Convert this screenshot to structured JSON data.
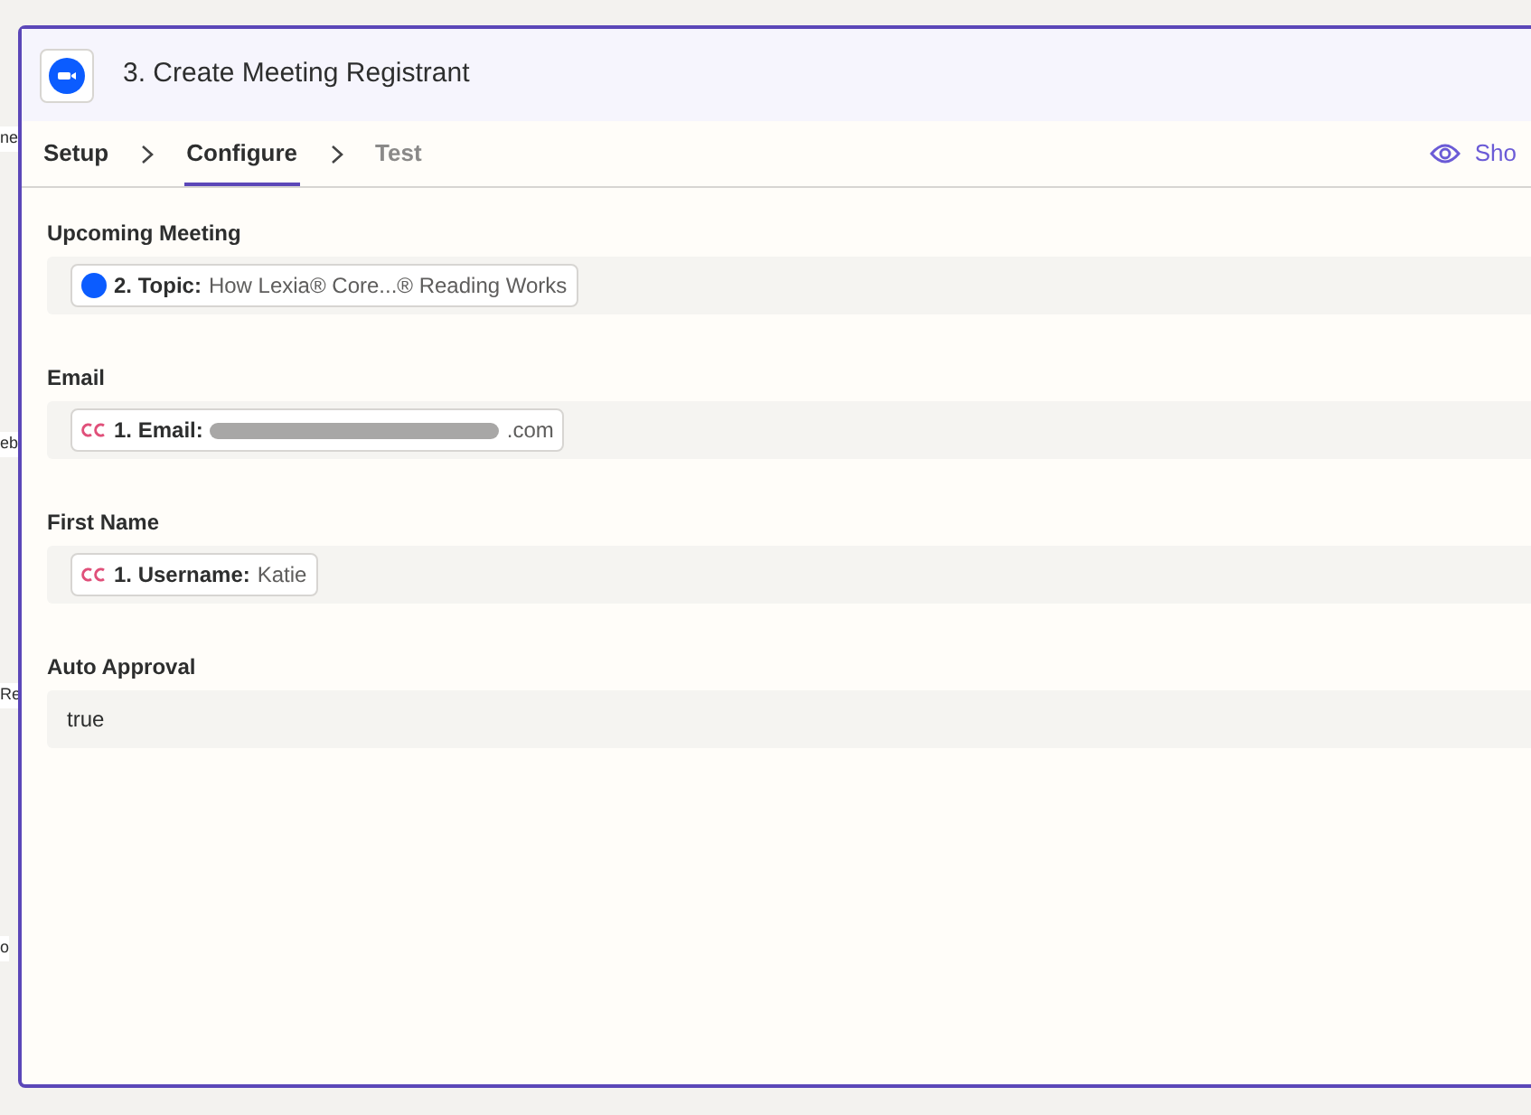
{
  "background_fragments": [
    "ne",
    "eb",
    "Re",
    "o"
  ],
  "panel": {
    "title": "3. Create Meeting Registrant",
    "steps": [
      {
        "label": "Setup",
        "selected": false,
        "disabled": false
      },
      {
        "label": "Configure",
        "selected": true,
        "disabled": false
      },
      {
        "label": "Test",
        "selected": false,
        "disabled": true
      }
    ],
    "show_link": "Sho",
    "fields": [
      {
        "label": "Upcoming Meeting",
        "kind": "zoom_pill",
        "pill_label": "2. Topic:",
        "pill_value": "How Lexia® Core...® Reading Works"
      },
      {
        "label": "Email",
        "kind": "redacted_cc_pill",
        "pill_label": "1. Email:",
        "pill_value": ".com"
      },
      {
        "label": "First Name",
        "kind": "cc_pill",
        "pill_label": "1. Username:",
        "pill_value": "Katie"
      },
      {
        "label": "Auto Approval",
        "kind": "text",
        "value": "true"
      }
    ]
  }
}
